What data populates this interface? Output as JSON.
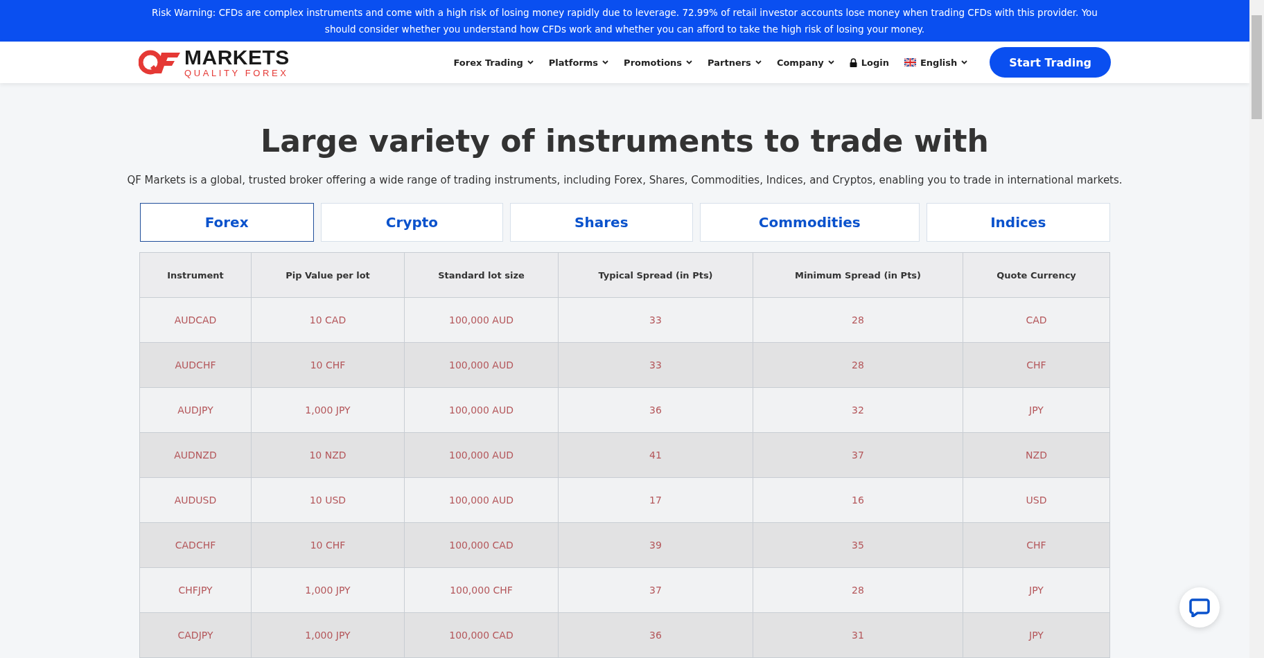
{
  "risk_warning": "Risk Warning: CFDs are complex instruments and come with a high risk of losing money rapidly due to leverage. 72.99% of retail investor accounts lose money when trading CFDs with this provider. You should consider whether you understand how CFDs work and whether you can afford to take the high risk of losing your money.",
  "logo": {
    "name": "MARKETS",
    "tagline": "QUALITY FOREX"
  },
  "nav": [
    {
      "label": "Forex Trading",
      "kind": "dropdown"
    },
    {
      "label": "Platforms",
      "kind": "dropdown"
    },
    {
      "label": "Promotions",
      "kind": "dropdown"
    },
    {
      "label": "Partners",
      "kind": "dropdown"
    },
    {
      "label": "Company",
      "kind": "dropdown"
    },
    {
      "label": "Login",
      "kind": "login"
    },
    {
      "label": "English",
      "kind": "language"
    }
  ],
  "cta": "Start Trading",
  "heading": "Large variety of instruments to trade with",
  "intro": "QF Markets is a global, trusted broker offering a wide range of trading instruments, including Forex, Shares, Commodities, Indices, and Cryptos, enabling you to trade in international markets.",
  "tabs": [
    {
      "label": "Forex",
      "selected": true
    },
    {
      "label": "Crypto",
      "selected": false
    },
    {
      "label": "Shares",
      "selected": false
    },
    {
      "label": "Commodities",
      "selected": false
    },
    {
      "label": "Indices",
      "selected": false
    }
  ],
  "table": {
    "columns": [
      "Instrument",
      "Pip Value per lot",
      "Standard lot size",
      "Typical Spread (in Pts)",
      "Minimum Spread (in Pts)",
      "Quote Currency"
    ],
    "rows": [
      [
        "AUDCAD",
        "10 CAD",
        "100,000 AUD",
        "33",
        "28",
        "CAD"
      ],
      [
        "AUDCHF",
        "10 CHF",
        "100,000 AUD",
        "33",
        "28",
        "CHF"
      ],
      [
        "AUDJPY",
        "1,000 JPY",
        "100,000 AUD",
        "36",
        "32",
        "JPY"
      ],
      [
        "AUDNZD",
        "10 NZD",
        "100,000 AUD",
        "41",
        "37",
        "NZD"
      ],
      [
        "AUDUSD",
        "10 USD",
        "100,000 AUD",
        "17",
        "16",
        "USD"
      ],
      [
        "CADCHF",
        "10 CHF",
        "100,000 CAD",
        "39",
        "35",
        "CHF"
      ],
      [
        "CHFJPY",
        "1,000 JPY",
        "100,000 CHF",
        "37",
        "28",
        "JPY"
      ],
      [
        "CADJPY",
        "1,000 JPY",
        "100,000 CAD",
        "36",
        "31",
        "JPY"
      ]
    ]
  }
}
